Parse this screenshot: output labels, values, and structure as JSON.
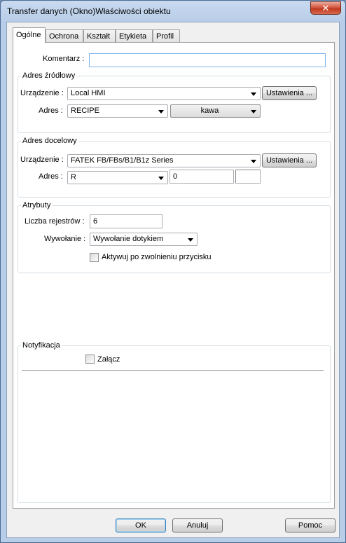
{
  "window": {
    "title": "Transfer danych (Okno)Właściwości obiektu",
    "close_glyph": "✕"
  },
  "tabs": [
    "Ogólne",
    "Ochrona",
    "Kształt",
    "Etykieta",
    "Profil"
  ],
  "comment": {
    "label": "Komentarz :",
    "value": ""
  },
  "source": {
    "title": "Adres źródłowy",
    "device_label": "Urządzenie :",
    "device_value": "Local HMI",
    "settings_label": "Ustawienia ...",
    "address_label": "Adres :",
    "address_value": "RECIPE",
    "address_sub_value": "kawa"
  },
  "target": {
    "title": "Adres docelowy",
    "device_label": "Urządzenie :",
    "device_value": "FATEK FB/FBs/B1/B1z Series",
    "settings_label": "Ustawienia ...",
    "address_label": "Adres :",
    "address_value": "R",
    "address_number": "0",
    "address_extra": ""
  },
  "attributes": {
    "title": "Atrybuty",
    "register_count_label": "Liczba rejestrów :",
    "register_count_value": "6",
    "trigger_label": "Wywołanie :",
    "trigger_value": "Wywołanie dotykiem",
    "activate_on_release_label": "Aktywuj po zwolnieniu przycisku"
  },
  "notification": {
    "title": "Notyfikacja",
    "enable_label": "Załącz"
  },
  "buttons": {
    "ok": "OK",
    "cancel": "Anuluj",
    "help": "Pomoc"
  }
}
